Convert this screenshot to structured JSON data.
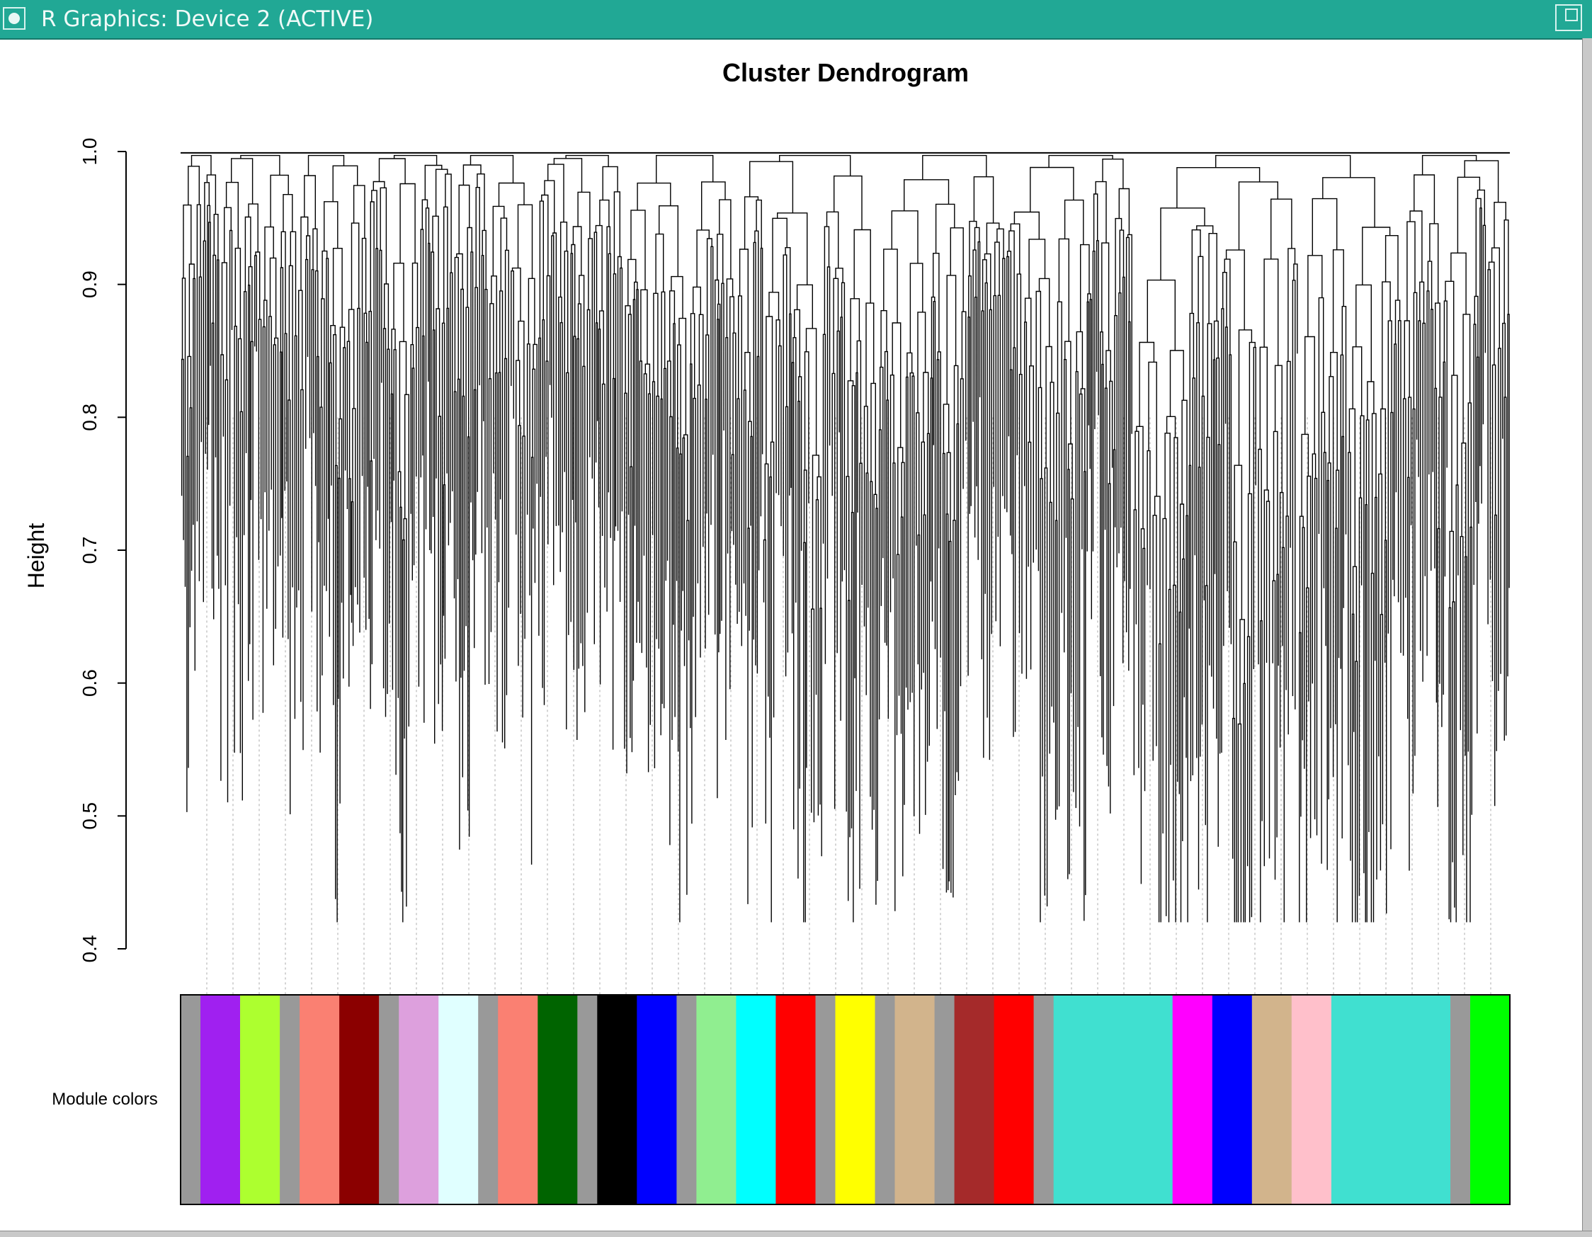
{
  "window": {
    "title": "R Graphics: Device 2 (ACTIVE)",
    "menu_icon": "window-menu-icon",
    "maximize_icon": "maximize-icon"
  },
  "chart_data": {
    "type": "dendrogram",
    "title": "Cluster Dendrogram",
    "xlabel": "",
    "ylabel": "Height",
    "ylim": [
      0.4,
      1.0
    ],
    "yticks": [
      0.4,
      0.5,
      0.6,
      0.7,
      0.8,
      0.9,
      1.0
    ],
    "ytick_labels": [
      "0.4",
      "0.5",
      "0.6",
      "0.7",
      "0.8",
      "0.9",
      "1.0"
    ],
    "color_bar_label": "Module colors",
    "module_colors": [
      "grey",
      "purple",
      "greenyellow",
      "grey",
      "salmon",
      "darkred",
      "grey",
      "plum",
      "lightcyan",
      "grey",
      "salmon",
      "darkgreen",
      "grey",
      "black",
      "blue",
      "grey",
      "lightgreen",
      "cyan",
      "red",
      "grey",
      "yellow",
      "grey",
      "tan",
      "grey",
      "brown",
      "red",
      "grey",
      "turquoise",
      "magenta",
      "blue",
      "tan",
      "pink",
      "turquoise",
      "grey",
      "green"
    ],
    "module_color_values": {
      "grey": "#999999",
      "purple": "#a020f0",
      "greenyellow": "#adff2f",
      "salmon": "#fa8072",
      "darkred": "#8b0000",
      "plum": "#dda0dd",
      "lightcyan": "#e0ffff",
      "darkgreen": "#006400",
      "black": "#000000",
      "blue": "#0000ff",
      "lightgreen": "#90ee90",
      "cyan": "#00ffff",
      "red": "#ff0000",
      "yellow": "#ffff00",
      "tan": "#d2b48c",
      "brown": "#a52a2a",
      "turquoise": "#40e0d0",
      "magenta": "#ff00ff",
      "pink": "#ffc0cb",
      "green": "#00ff00"
    }
  }
}
